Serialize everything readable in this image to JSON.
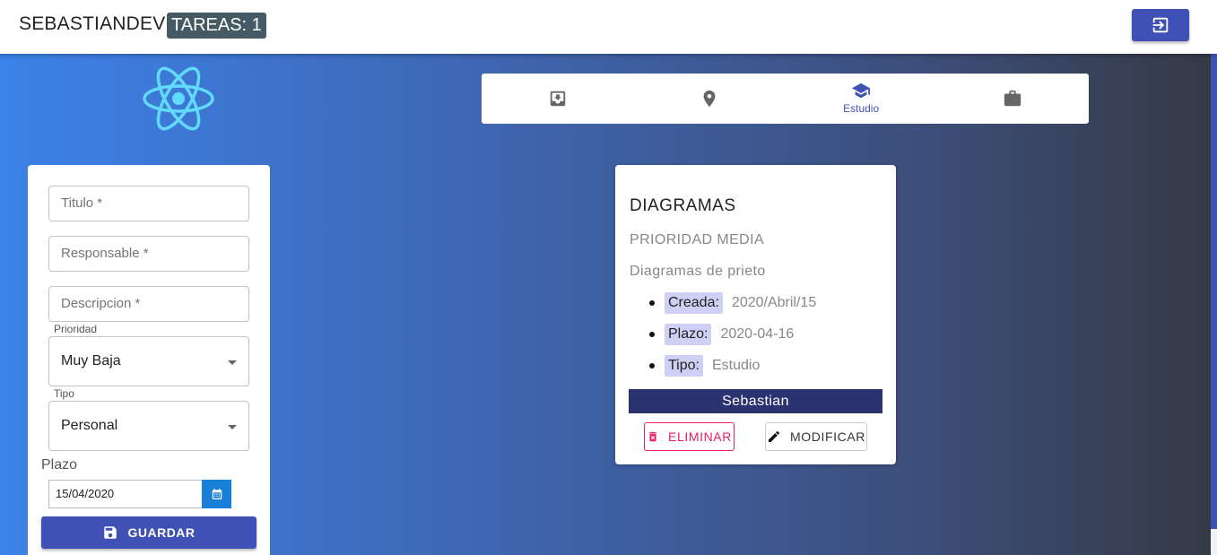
{
  "header": {
    "brand": "SEBASTIANDEV",
    "task_count_label": "TAREAS: 1"
  },
  "tabs": [
    {
      "icon": "inbox-icon",
      "label": ""
    },
    {
      "icon": "map-pin-icon",
      "label": ""
    },
    {
      "icon": "graduation-cap-icon",
      "label": "Estudio",
      "active": true
    },
    {
      "icon": "briefcase-icon",
      "label": ""
    }
  ],
  "form": {
    "title_placeholder": "Titulo *",
    "responsible_placeholder": "Responsable *",
    "description_placeholder": "Descripcion *",
    "priority_label": "Prioridad",
    "priority_value": "Muy Baja",
    "type_label": "Tipo",
    "type_value": "Personal",
    "deadline_label": "Plazo",
    "deadline_value": "15/04/2020",
    "save_label": "GUARDAR"
  },
  "task": {
    "title": "DIAGRAMAS",
    "priority": "PRIORIDAD MEDIA",
    "description": "Diagramas de prieto",
    "details": [
      {
        "label": "Creada:",
        "value": "2020/Abril/15"
      },
      {
        "label": "Plazo:",
        "value": "2020-04-16"
      },
      {
        "label": "Tipo:",
        "value": "Estudio"
      }
    ],
    "owner": "Sebastian",
    "delete_label": "ELIMINAR",
    "modify_label": "MODIFICAR"
  },
  "colors": {
    "primary": "#3f51b5",
    "badge": "#455a64",
    "danger": "#e91e63",
    "chip": "#cfd0f5",
    "owner_bar": "#2b3270"
  }
}
